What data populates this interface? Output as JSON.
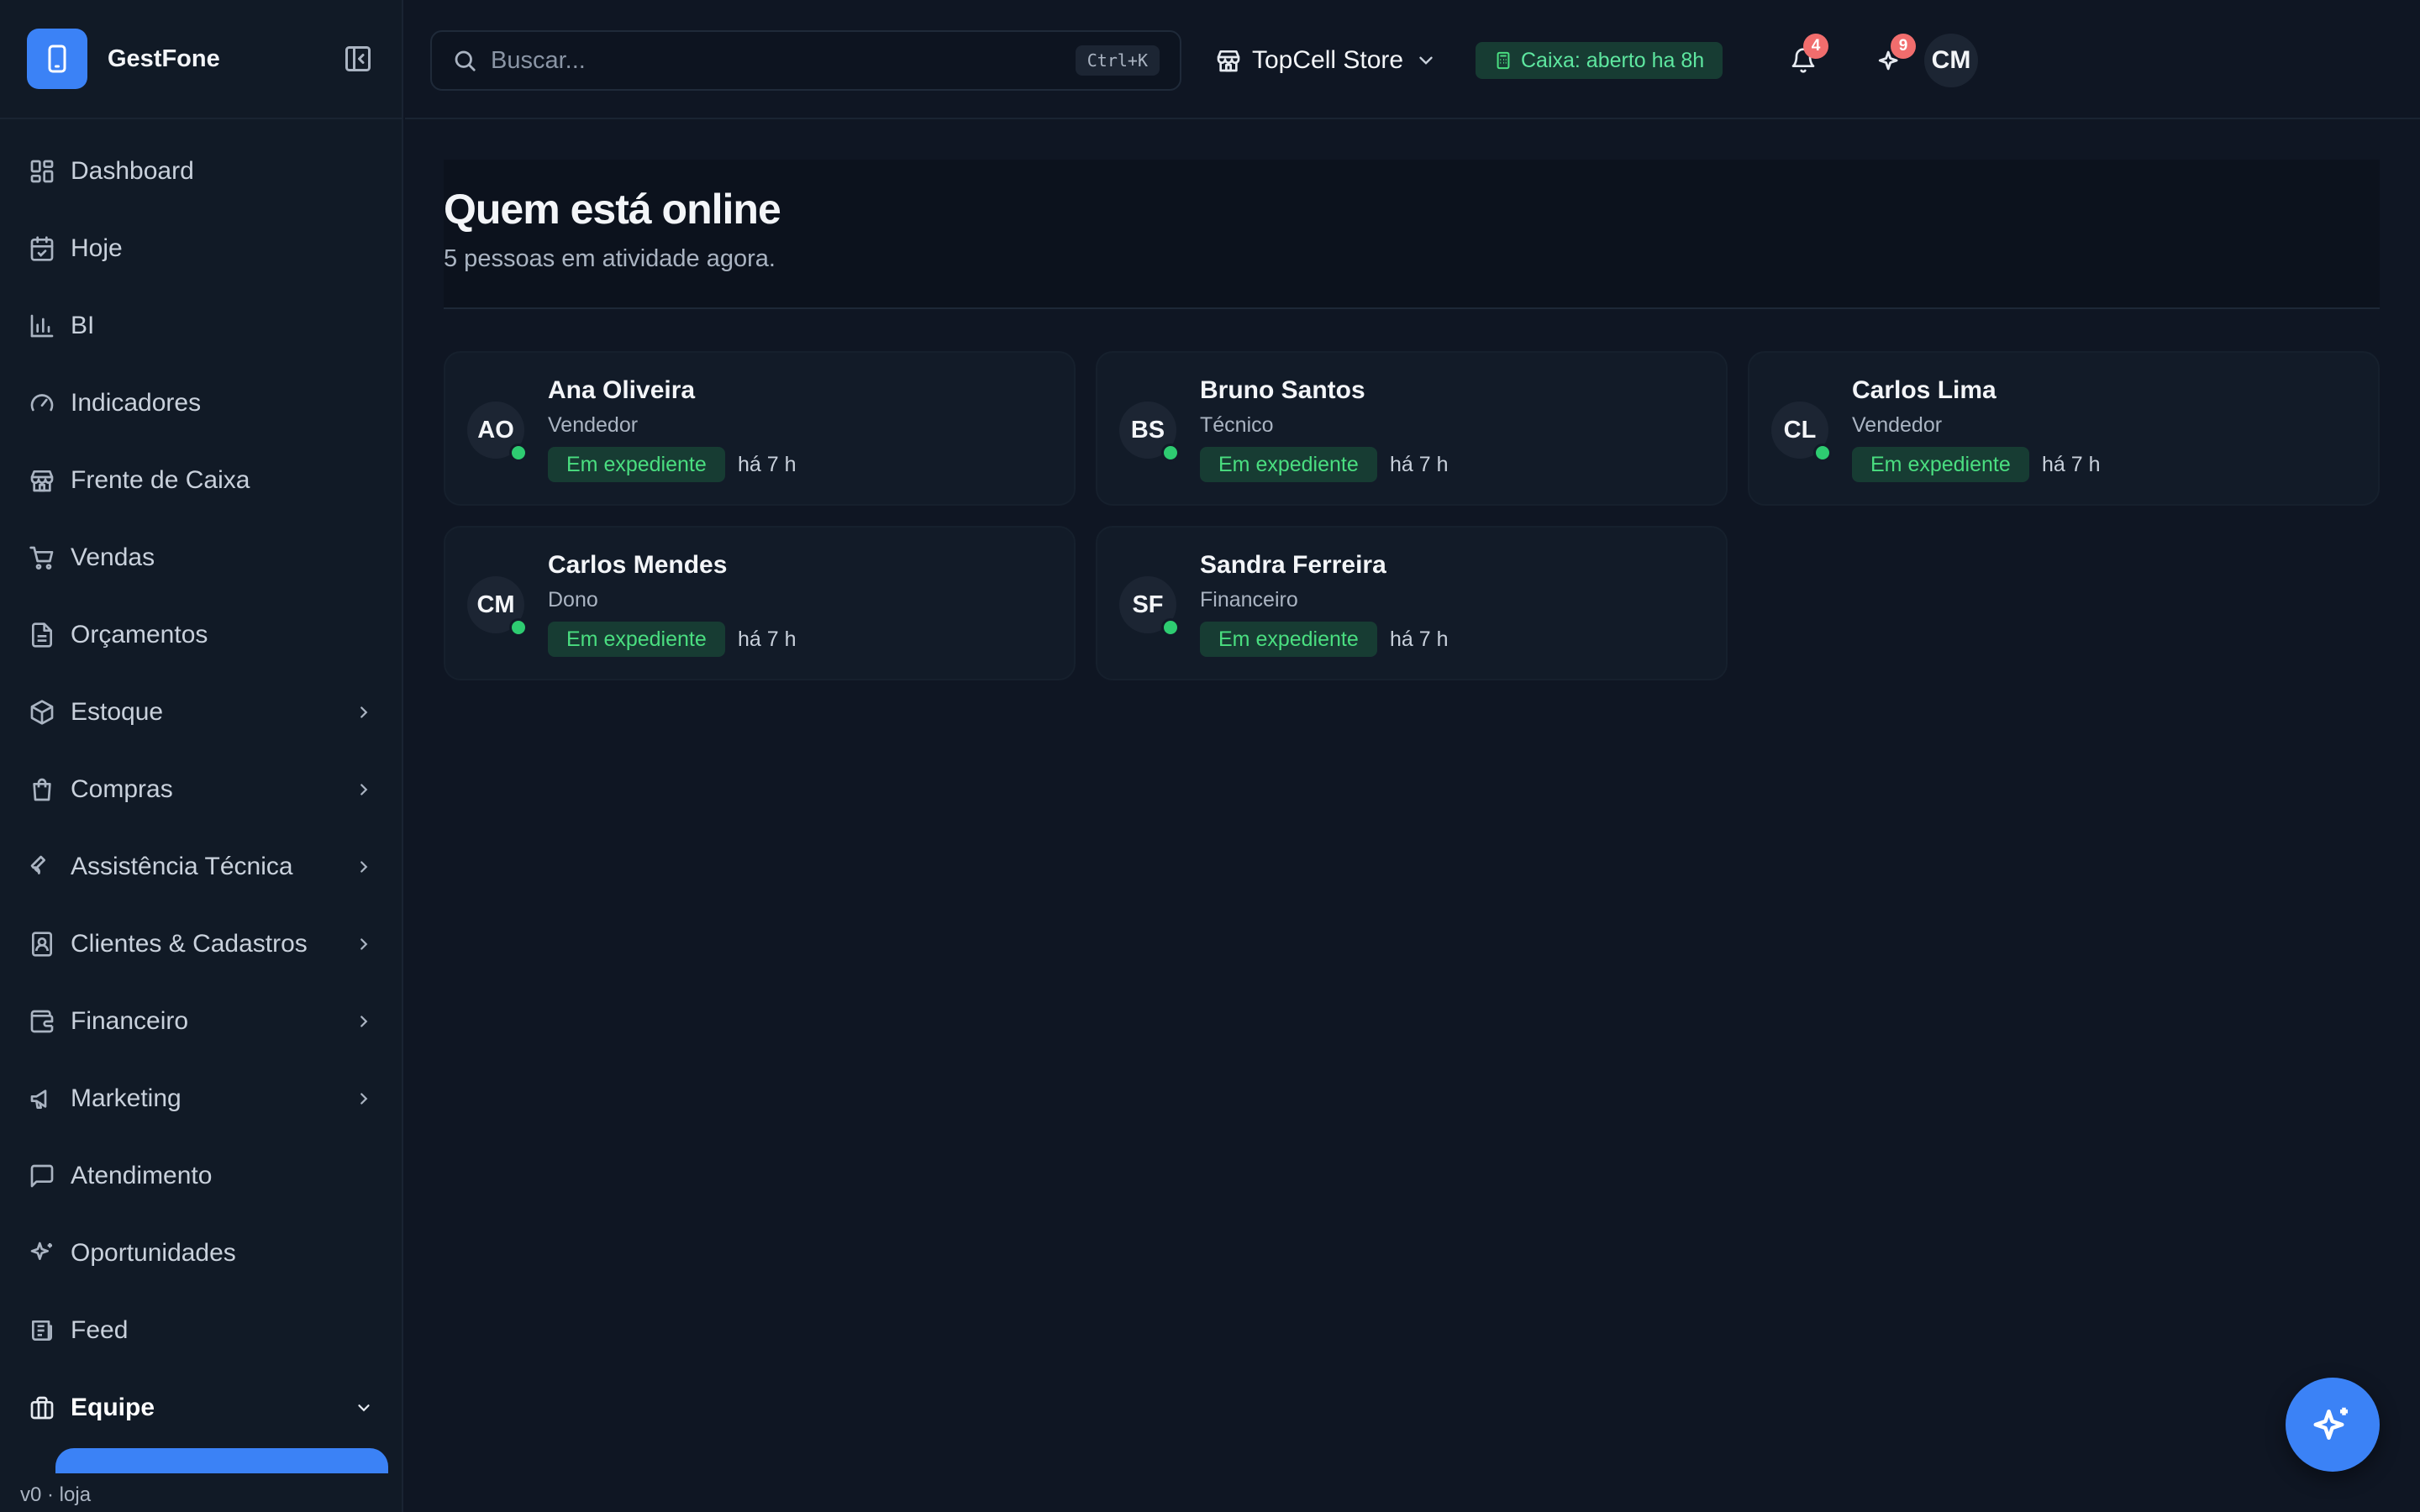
{
  "app": {
    "name": "GestFone",
    "version": "v0 · loja"
  },
  "sidebar": {
    "items": [
      {
        "label": "Dashboard",
        "icon": "dashboard-icon"
      },
      {
        "label": "Hoje",
        "icon": "calendar-check-icon"
      },
      {
        "label": "BI",
        "icon": "bar-chart-icon"
      },
      {
        "label": "Indicadores",
        "icon": "gauge-icon"
      },
      {
        "label": "Frente de Caixa",
        "icon": "store-icon"
      },
      {
        "label": "Vendas",
        "icon": "cart-icon"
      },
      {
        "label": "Orçamentos",
        "icon": "document-icon"
      },
      {
        "label": "Estoque",
        "icon": "package-icon",
        "expandable": true
      },
      {
        "label": "Compras",
        "icon": "shopping-bag-icon",
        "expandable": true
      },
      {
        "label": "Assistência Técnica",
        "icon": "wrench-icon",
        "expandable": true
      },
      {
        "label": "Clientes & Cadastros",
        "icon": "contacts-icon",
        "expandable": true
      },
      {
        "label": "Financeiro",
        "icon": "wallet-icon",
        "expandable": true
      },
      {
        "label": "Marketing",
        "icon": "megaphone-icon",
        "expandable": true
      },
      {
        "label": "Atendimento",
        "icon": "chat-icon"
      },
      {
        "label": "Oportunidades",
        "icon": "sparkles-icon"
      },
      {
        "label": "Feed",
        "icon": "newspaper-icon"
      },
      {
        "label": "Equipe",
        "icon": "briefcase-icon",
        "expanded": true,
        "active": true
      }
    ]
  },
  "topbar": {
    "search_placeholder": "Buscar...",
    "search_shortcut": "Ctrl+K",
    "store_name": "TopCell Store",
    "caixa_status": "Caixa: aberto ha 8h",
    "notifications_count": "4",
    "suggestions_count": "9",
    "user_initials": "CM"
  },
  "page": {
    "title": "Quem está online",
    "subtitle": "5 pessoas em atividade agora."
  },
  "online_users": [
    {
      "initials": "AO",
      "name": "Ana Oliveira",
      "role": "Vendedor",
      "status": "Em expediente",
      "since": "há 7 h"
    },
    {
      "initials": "BS",
      "name": "Bruno Santos",
      "role": "Técnico",
      "status": "Em expediente",
      "since": "há 7 h"
    },
    {
      "initials": "CL",
      "name": "Carlos Lima",
      "role": "Vendedor",
      "status": "Em expediente",
      "since": "há 7 h"
    },
    {
      "initials": "CM",
      "name": "Carlos Mendes",
      "role": "Dono",
      "status": "Em expediente",
      "since": "há 7 h"
    },
    {
      "initials": "SF",
      "name": "Sandra Ferreira",
      "role": "Financeiro",
      "status": "Em expediente",
      "since": "há 7 h"
    }
  ],
  "colors": {
    "accent": "#3b82f6",
    "online": "#2ecc71",
    "status_text": "#4ade80",
    "badge": "#f16d6d"
  }
}
